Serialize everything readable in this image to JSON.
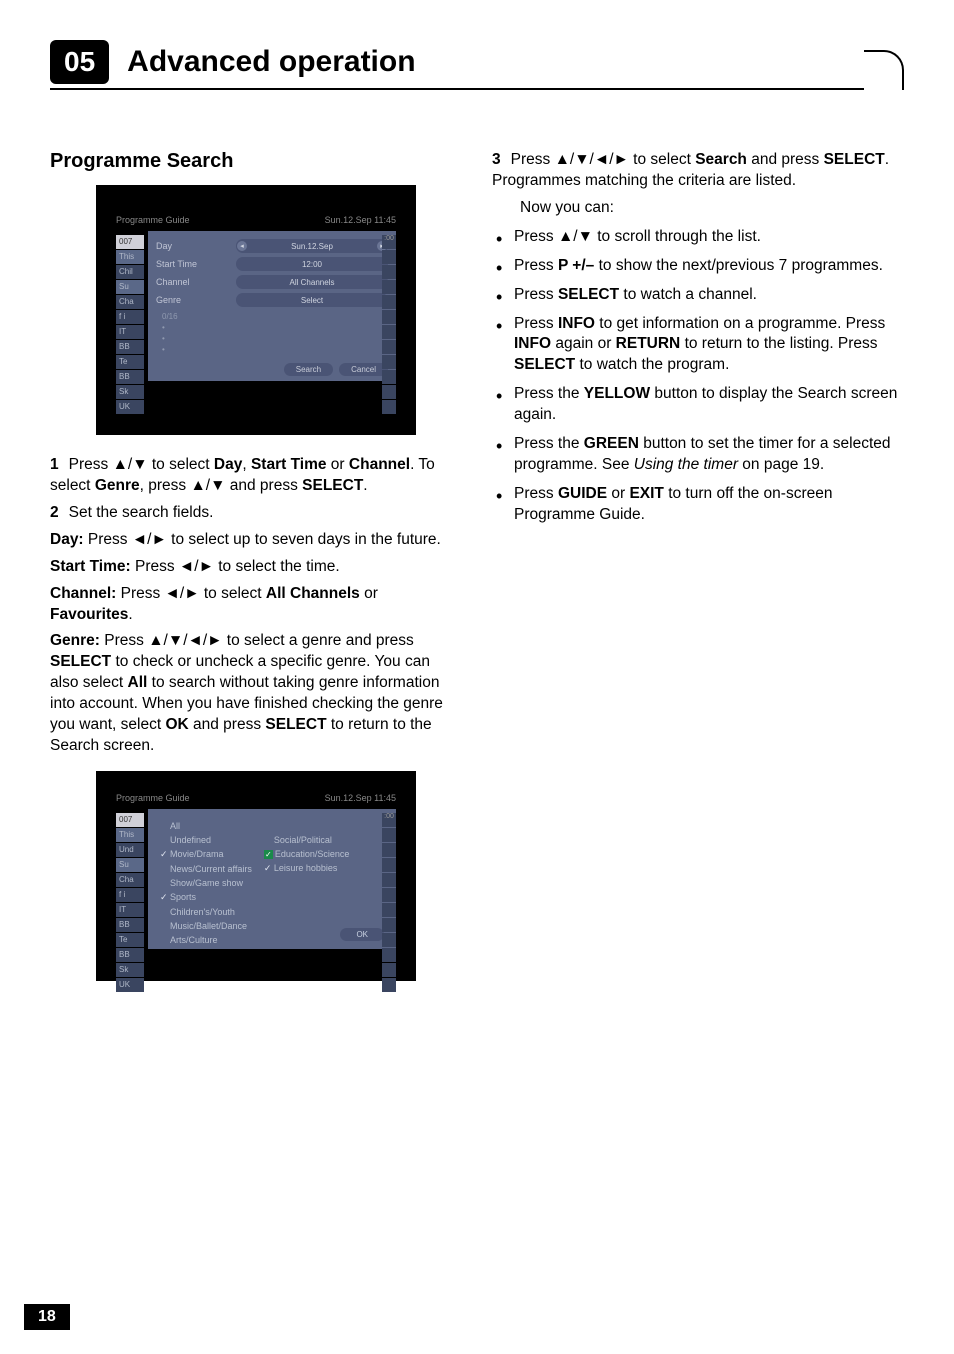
{
  "header": {
    "chapter_number": "05",
    "chapter_title": "Advanced operation"
  },
  "section_title": "Programme Search",
  "screenshot1": {
    "header_left": "Programme Guide",
    "header_right": "Sun.12.Sep  11:45",
    "sidebar": [
      "007",
      "This",
      "Chil",
      "Su",
      "Cha",
      "f i",
      "IT",
      "BB",
      "Te",
      "BB",
      "Sk",
      "UK"
    ],
    "rows": {
      "day_label": "Day",
      "day_value": "Sun.12.Sep",
      "start_label": "Start Time",
      "start_value": "12:00",
      "channel_label": "Channel",
      "channel_value": "All Channels",
      "genre_label": "Genre",
      "genre_value": "Select",
      "count": "0/16"
    },
    "buttons": {
      "search": "Search",
      "cancel": "Cancel"
    },
    "right_strip_top": ":00"
  },
  "screenshot2": {
    "header_left": "Programme Guide",
    "header_right": "Sun.12.Sep  11:45",
    "sidebar": [
      "007",
      "This",
      "Und",
      "Su",
      "Cha",
      "f i",
      "IT",
      "BB",
      "Te",
      "BB",
      "Sk",
      "UK"
    ],
    "left_genres": [
      "All",
      "Undefined",
      "Movie/Drama",
      "News/Current affairs",
      "Show/Game show",
      "Sports",
      "Children's/Youth",
      "Music/Ballet/Dance",
      "Arts/Culture"
    ],
    "right_genres": [
      "Social/Political",
      "Education/Science",
      "Leisure hobbies"
    ],
    "checked_left": [
      2,
      5
    ],
    "checked_right": [
      1,
      2
    ],
    "green_right": [
      1
    ],
    "ok": "OK",
    "right_strip_top": ":00"
  },
  "left_body": {
    "step1_prefix": "1",
    "step1_a": "Press ",
    "step1_arrows1": "▲/▼",
    "step1_b": " to select ",
    "step1_day": "Day",
    "step1_c": ", ",
    "step1_start": "Start Time",
    "step1_d": " or ",
    "step1_channel": "Channel",
    "step1_e": ". To select ",
    "step1_genre": "Genre",
    "step1_f": ", press ",
    "step1_arrows2": "▲/▼",
    "step1_g": " and press ",
    "step1_select": "SELECT",
    "step1_h": ".",
    "step2_prefix": "2",
    "step2_text": "Set the search fields.",
    "day_lbl": "Day:",
    "day_a": " Press ",
    "day_arrows": "◄/►",
    "day_b": " to select up to seven days in the future.",
    "st_lbl": "Start Time:",
    "st_a": " Press ",
    "st_arrows": "◄/►",
    "st_b": " to select the time.",
    "ch_lbl": "Channel:",
    "ch_a": " Press ",
    "ch_arrows": "◄/►",
    "ch_b": " to select ",
    "ch_all": "All Channels",
    "ch_c": " or ",
    "ch_fav": "Favourites",
    "ch_d": ".",
    "gn_lbl": "Genre:",
    "gn_a": " Press ",
    "gn_arrows": "▲/▼/◄/►",
    "gn_b": " to select a genre and press ",
    "gn_select": "SELECT",
    "gn_c": " to check or uncheck a specific genre. You can also select ",
    "gn_all": "All",
    "gn_d": " to search without taking genre information into account. When you have finished checking the genre you want, select ",
    "gn_ok": "OK",
    "gn_e": " and press ",
    "gn_select2": "SELECT",
    "gn_f": " to return to the Search screen."
  },
  "right_body": {
    "step3_prefix": "3",
    "step3_a": "Press ",
    "step3_arrows": "▲/▼/◄/►",
    "step3_b": " to select ",
    "step3_search": "Search",
    "step3_c": " and press ",
    "step3_select": "SELECT",
    "step3_d": ". Programmes matching the criteria are listed.",
    "nowyoucan": "Now you can:",
    "b1_a": "Press ",
    "b1_arrows": "▲/▼",
    "b1_b": " to scroll through the list.",
    "b2_a": "Press ",
    "b2_key": "P +/–",
    "b2_b": " to show the next/previous 7 programmes.",
    "b3_a": "Press ",
    "b3_key": "SELECT",
    "b3_b": " to watch a channel.",
    "b4_a": "Press ",
    "b4_key1": "INFO",
    "b4_b": " to get information on a programme. Press ",
    "b4_key2": "INFO",
    "b4_c": " again or ",
    "b4_key3": "RETURN",
    "b4_d": " to return to the listing. Press ",
    "b4_key4": "SELECT",
    "b4_e": " to watch the program.",
    "b5_a": "Press the ",
    "b5_key": "YELLOW",
    "b5_b": " button to display the Search screen again.",
    "b6_a": "Press the ",
    "b6_key": "GREEN",
    "b6_b": " button to set the timer for a selected programme. See ",
    "b6_ital": "Using the timer",
    "b6_c": " on page 19.",
    "b7_a": "Press ",
    "b7_key1": "GUIDE",
    "b7_b": " or ",
    "b7_key2": "EXIT",
    "b7_c": " to turn off the on-screen Programme Guide."
  },
  "page_number": "18"
}
